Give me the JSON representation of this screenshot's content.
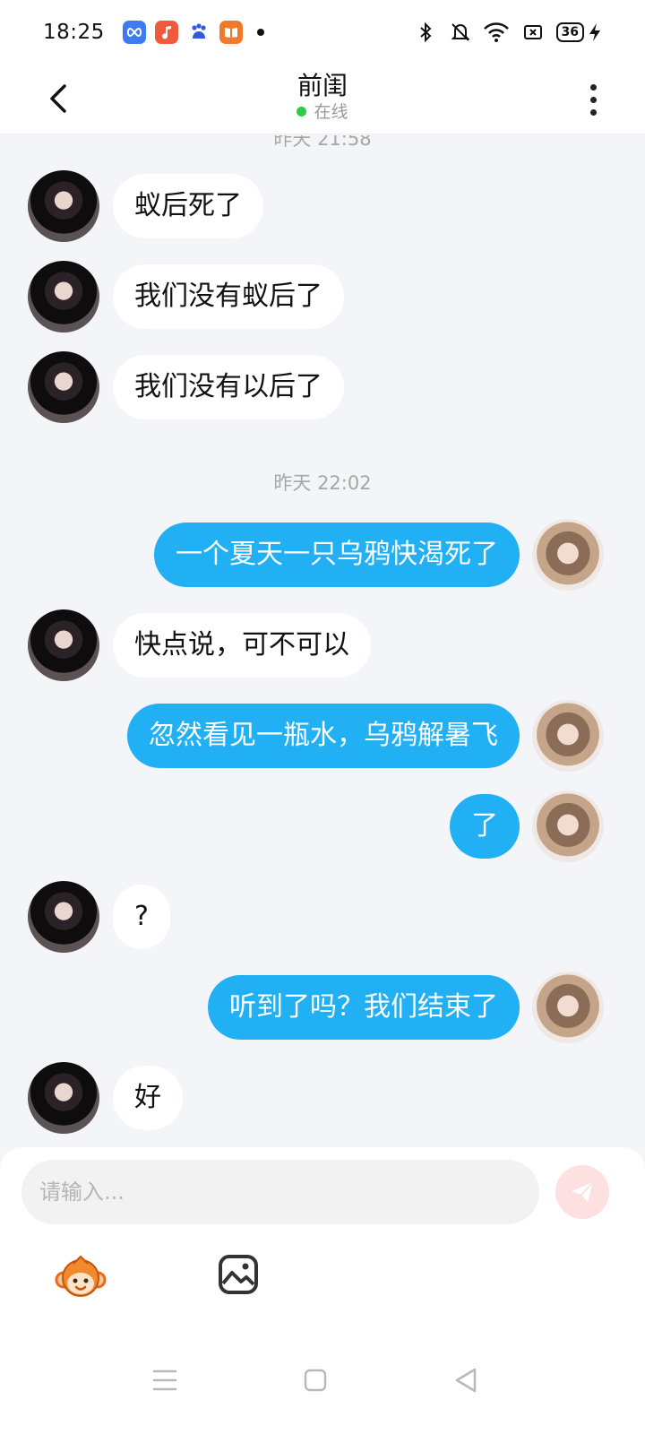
{
  "status_bar": {
    "time": "18:25",
    "app_icons": [
      {
        "name": "infinity-app-icon",
        "color": "#3d7bf0"
      },
      {
        "name": "music-app-icon",
        "color": "#f05a3c"
      },
      {
        "name": "baidu-app-icon",
        "color": "#ffffff"
      },
      {
        "name": "reader-app-icon",
        "color": "#f07a2a"
      }
    ],
    "battery": "36"
  },
  "header": {
    "title": "前闺",
    "status": "在线"
  },
  "chat": {
    "partial_timestamp": "昨天 21:58",
    "timestamp_2": "昨天 22:02",
    "messages": [
      {
        "side": "in",
        "text": "蚁后死了"
      },
      {
        "side": "in",
        "text": "我们没有蚁后了"
      },
      {
        "side": "in",
        "text": "我们没有以后了"
      },
      {
        "side": "out",
        "text": "一个夏天一只乌鸦快渴死了"
      },
      {
        "side": "in",
        "text": "快点说，可不可以"
      },
      {
        "side": "out",
        "text": "忽然看见一瓶水，乌鸦解暑飞"
      },
      {
        "side": "out",
        "text": "了"
      },
      {
        "side": "in",
        "text": "?"
      },
      {
        "side": "out",
        "text": "听到了吗？我们结束了"
      },
      {
        "side": "in",
        "text": "好"
      }
    ]
  },
  "input": {
    "placeholder": "请输入..."
  },
  "colors": {
    "accent_bubble": "#22b0f4",
    "send_button_bg": "#fde0e0",
    "online": "#2ecc40"
  },
  "icons": {
    "back": "back-arrow-icon",
    "more": "more-vertical-icon",
    "send": "paper-plane-icon",
    "emoji": "monkey-emoji-icon",
    "image": "image-icon"
  }
}
